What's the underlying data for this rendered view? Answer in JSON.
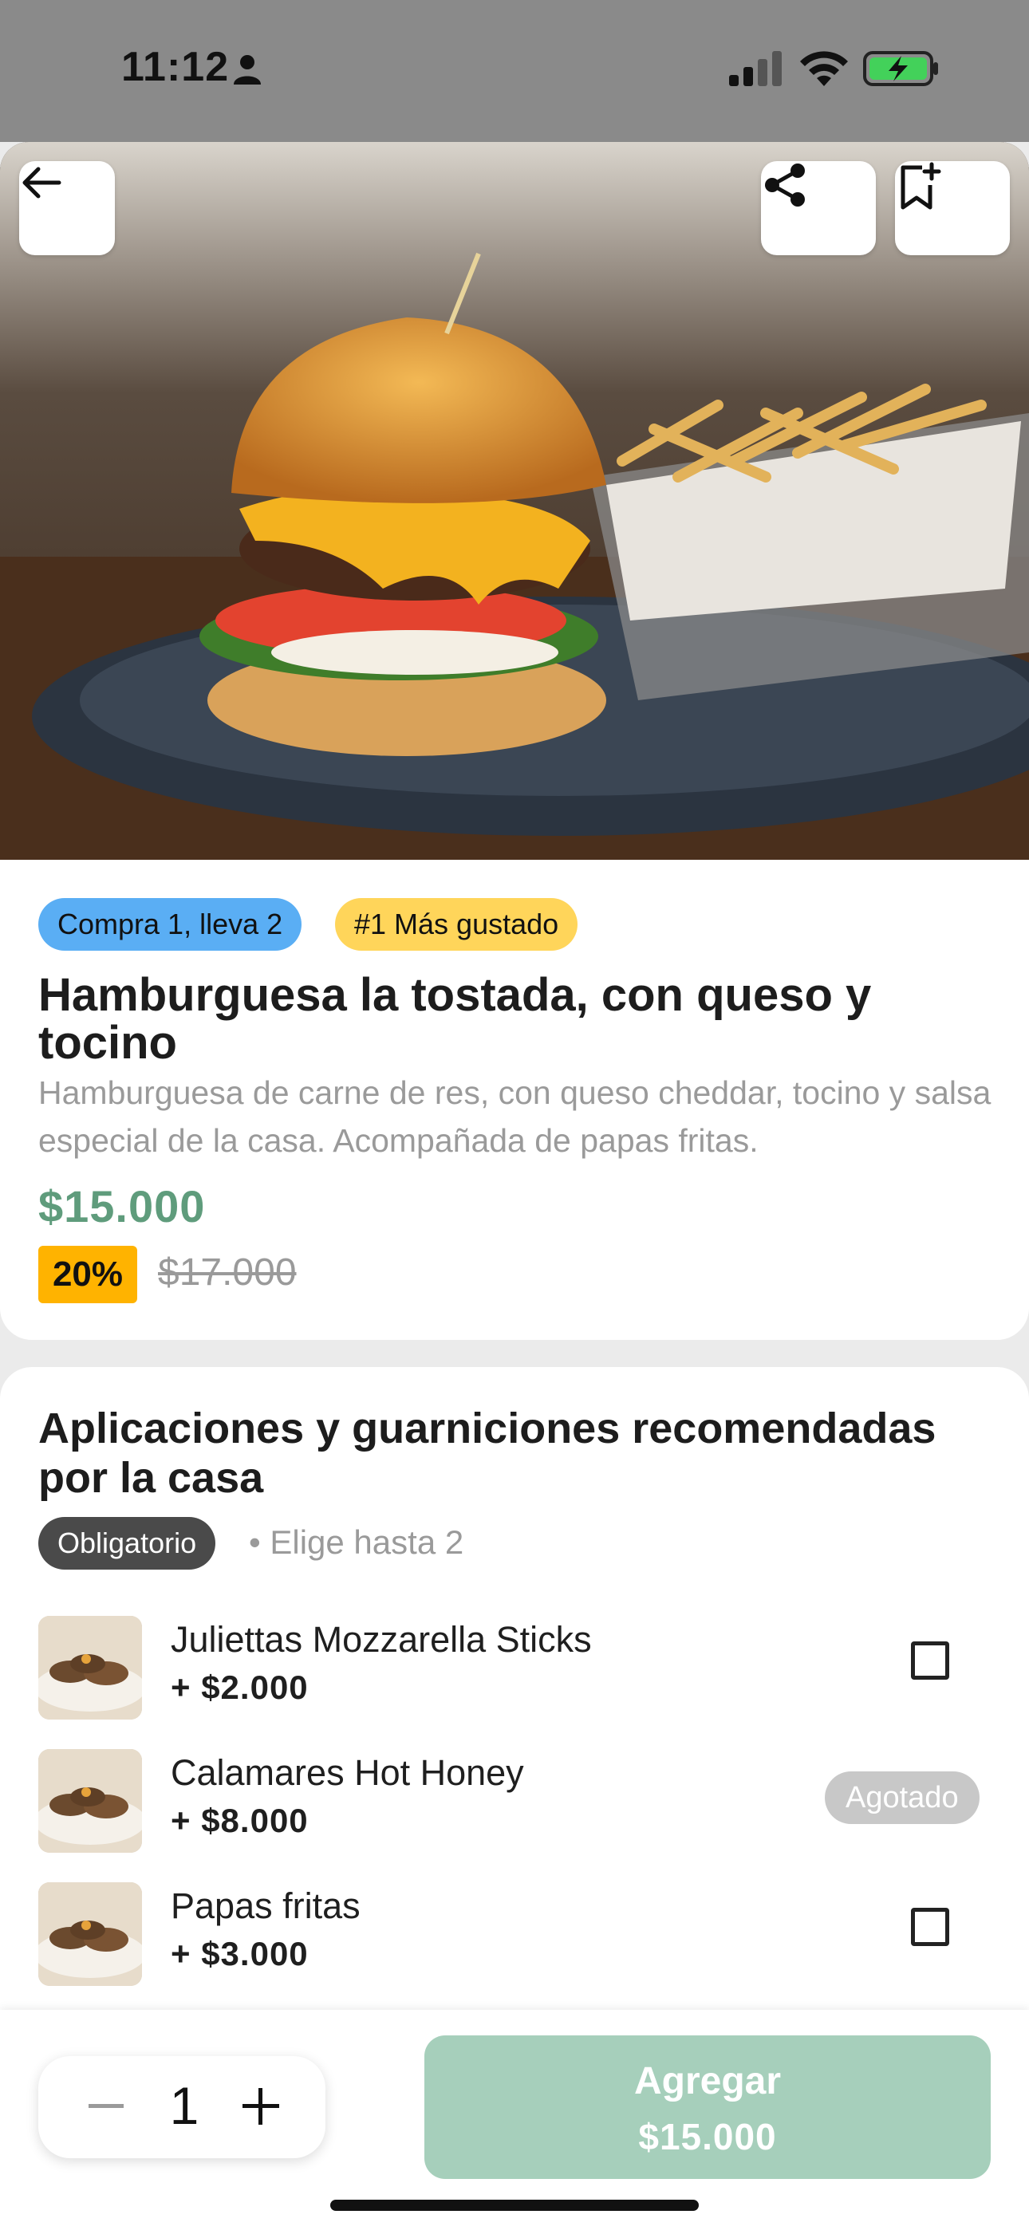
{
  "status_bar": {
    "time": "11:12"
  },
  "hero": {
    "back_icon": "arrow-left-icon",
    "share_icon": "share-icon",
    "save_icon": "bookmark-add-icon"
  },
  "product": {
    "tags": [
      "Compra 1, lleva 2",
      "#1 Más gustado"
    ],
    "title": "Hamburguesa la tostada, con queso y tocino",
    "description": "Hamburguesa de carne de res, con queso cheddar, tocino y salsa especial de la casa. Acompañada de papas fritas.",
    "price": "$15.000",
    "discount": "20%",
    "old_price": "$17.000"
  },
  "options": {
    "title": "Aplicaciones y guarniciones recomendadas por la casa",
    "required_label": "Obligatorio",
    "hint": "• Elige hasta 2",
    "items": [
      {
        "name": "Juliettas Mozzarella Sticks",
        "price": "+ $2.000",
        "status": ""
      },
      {
        "name": "Calamares Hot Honey",
        "price": "+ $8.000",
        "status": "Agotado"
      },
      {
        "name": "Papas fritas",
        "price": "+ $3.000",
        "status": ""
      }
    ]
  },
  "footer": {
    "quantity": "1",
    "add_label": "Agregar",
    "add_price": "$15.000"
  },
  "colors": {
    "price_green": "#5f9c7c",
    "add_button": "#a6cfbb",
    "promo_tag": "#5aaef4",
    "popular_tag": "#ffd55a",
    "discount_badge": "#ffb300"
  }
}
